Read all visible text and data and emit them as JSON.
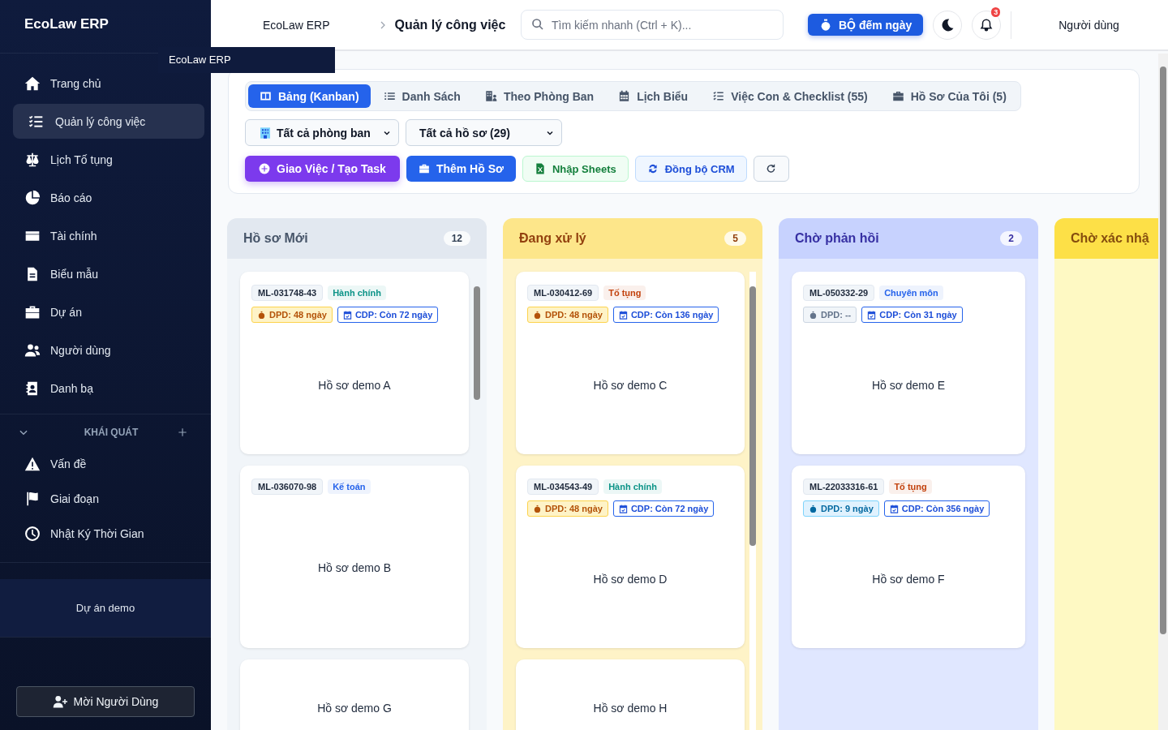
{
  "sidebar": {
    "brand": "EcoLaw ERP",
    "tooltip": "EcoLaw ERP",
    "items": [
      {
        "label": "Trang chủ",
        "selected": false
      },
      {
        "label": "Quản lý công việc",
        "selected": true
      },
      {
        "label": "Lịch Tố tụng",
        "selected": false
      },
      {
        "label": "Báo cáo",
        "selected": false
      },
      {
        "label": "Tài chính",
        "selected": false
      },
      {
        "label": "Biểu mẫu",
        "selected": false
      },
      {
        "label": "Dự án",
        "selected": false
      },
      {
        "label": "Người dùng",
        "selected": false
      },
      {
        "label": "Danh bạ",
        "selected": false
      }
    ],
    "section": {
      "title": "KHÁI QUÁT",
      "expanded": true,
      "items": [
        {
          "label": "Vấn đề",
          "selected": false
        },
        {
          "label": "Giai đoạn",
          "selected": false
        },
        {
          "label": "Nhật Ký Thời Gian",
          "selected": false
        }
      ]
    },
    "project": "Dự án demo",
    "invite_button": "Mời Người Dùng"
  },
  "header": {
    "breadcrumb": [
      "EcoLaw ERP",
      "Quản lý công việc"
    ],
    "search": {
      "placeholder": "Tìm kiếm nhanh (Ctrl + K)..."
    },
    "counter_button": "BỘ đếm ngày",
    "notifications": "3",
    "user": "Người dùng"
  },
  "tabs": [
    {
      "label": "Bảng (Kanban)",
      "selected": true
    },
    {
      "label": "Danh Sách",
      "selected": false
    },
    {
      "label": "Theo Phòng Ban",
      "selected": false
    },
    {
      "label": "Lịch Biểu",
      "selected": false
    },
    {
      "label": "Việc Con & Checklist (55)",
      "selected": false
    },
    {
      "label": "Hồ Sơ Của Tôi (5)",
      "selected": false
    }
  ],
  "filters": [
    {
      "kind": "department",
      "value": "Tất cả phòng ban"
    },
    {
      "kind": "plain",
      "value": "Tất cả hồ sơ (29)"
    }
  ],
  "actions": [
    {
      "kind": "purple",
      "label": "Giao Việc / Tạo Task"
    },
    {
      "kind": "blue",
      "label": "Thêm Hồ Sơ"
    },
    {
      "kind": "sheets",
      "label": "Nhập Sheets"
    },
    {
      "kind": "sync",
      "label": "Đồng bộ CRM"
    },
    {
      "kind": "refresh"
    }
  ],
  "columns": [
    {
      "title": "Hồ sơ Mới",
      "count": "12",
      "kind": "slate",
      "scrollable": true,
      "cards": [
        {
          "code": "ML-031748-43",
          "department": "Hành chính",
          "color": "#0d9488",
          "dpd": {
            "kind": "warn",
            "text": "DPD: 48 ngày"
          },
          "cdp": "CDP: Còn 72 ngày",
          "title": "Hồ sơ demo A"
        },
        {
          "code": "ML-036070-98",
          "department": "Kế toán",
          "color": "#2563eb",
          "title": "Hồ sơ demo B"
        },
        {
          "title": "Hồ sơ demo G"
        }
      ]
    },
    {
      "title": "Đang xử lý",
      "count": "5",
      "kind": "amber",
      "scrollable": true,
      "cards": [
        {
          "code": "ML-030412-69",
          "department": "Tố tụng",
          "color": "#c2410c",
          "dpd": {
            "kind": "warn",
            "text": "DPD: 48 ngày"
          },
          "cdp": "CDP: Còn 136 ngày",
          "title": "Hồ sơ demo C"
        },
        {
          "code": "ML-034543-49",
          "department": "Hành chính",
          "color": "#0d9488",
          "dpd": {
            "kind": "warn",
            "text": "DPD: 48 ngày"
          },
          "cdp": "CDP: Còn 72 ngày",
          "title": "Hồ sơ demo D"
        },
        {
          "title": "Hồ sơ demo H"
        }
      ]
    },
    {
      "title": "Chờ phản hồi",
      "count": "2",
      "kind": "indigo",
      "scrollable": false,
      "cards": [
        {
          "code": "ML-050332-29",
          "department": "Chuyên môn",
          "color": "#2563eb",
          "dpd": {
            "kind": "none",
            "text": "DPD: --"
          },
          "cdp": "CDP: Còn 31 ngày",
          "title": "Hồ sơ demo E"
        },
        {
          "code": "ML-22033316-61",
          "department": "Tố tụng",
          "color": "#c2410c",
          "dpd": {
            "kind": "info",
            "text": "DPD: 9 ngày"
          },
          "cdp": "CDP: Còn 356 ngày",
          "title": "Hồ sơ demo F"
        }
      ]
    },
    {
      "title": "Chờ xác nhậ",
      "kind": "yellow"
    }
  ]
}
